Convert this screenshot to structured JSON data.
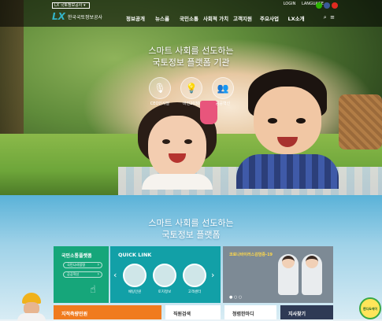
{
  "header": {
    "brand_badge": "LX 국토정보공사 ▾",
    "utility": [
      "LOGIN",
      "LANGUAGE ▾"
    ],
    "logo_mark": "LX",
    "logo_text": "한국국토정보공사",
    "nav": [
      "정보공개",
      "뉴스룸",
      "국민소통",
      "사회적 가치",
      "고객지원",
      "주요사업",
      "LX소개"
    ],
    "sns_colors": [
      "#2db400",
      "#3b5998",
      "#e02a20"
    ],
    "icons": [
      "search-icon",
      "menu-icon"
    ]
  },
  "hero": {
    "title_line1": "스마트 사회를 선도하는",
    "title_line2": "국토정보 플랫폼 기관",
    "quick_icons": [
      {
        "icon": "microphone-icon",
        "label": "CEO인사말"
      },
      {
        "icon": "lightbulb-icon",
        "label": "비전2030"
      },
      {
        "icon": "people-icon",
        "label": "공공혁신"
      }
    ]
  },
  "section": {
    "title_line1": "스마트 사회를 선도하는",
    "title_line2": "국토정보 플랫폼"
  },
  "cards": {
    "green": {
      "title": "국민소통플랫폼",
      "buttons": [
        "국민나라법령",
        "공공혁신"
      ]
    },
    "quick": {
      "title": "QUICK LINK",
      "items": [
        "채팅민원",
        "토지정보",
        "고객센터"
      ]
    },
    "notice": {
      "title": "코로나바이러스감염증-19"
    }
  },
  "bottom_tiles": [
    {
      "label": "지적측량민원",
      "bg": "#f07b1e",
      "color": "#ffffff"
    },
    {
      "label": "직원검색",
      "bg": "#ffffff",
      "color": "#333333"
    },
    {
      "label": "청렴한마디",
      "bg": "#ffffff",
      "color": "#333333"
    },
    {
      "label": "지사찾기",
      "bg": "#2f3a55",
      "color": "#ffffff"
    }
  ],
  "mascot_text": "랜디&에이"
}
